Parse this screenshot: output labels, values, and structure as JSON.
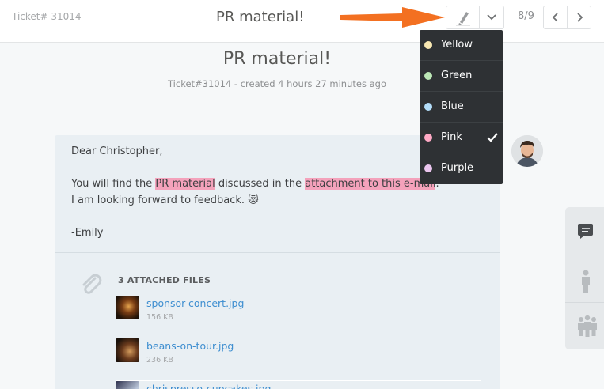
{
  "topbar": {
    "ticket_id": "Ticket# 31014",
    "title": "PR material!",
    "pager": "8/9"
  },
  "ticket": {
    "title": "PR material!",
    "meta": "Ticket#31014 - created 4 hours 27 minutes ago"
  },
  "article": {
    "greeting": "Dear Christopher,",
    "line1_pre": "You will find the ",
    "line1_hl1": "PR material",
    "line1_mid": " discussed in the ",
    "line1_hl2": "attachment to this e-mail",
    "line1_post": ".",
    "line2": "I am looking forward to feedback.",
    "emoji": "😻",
    "signature": "-Emily"
  },
  "attachments": {
    "title": "3 ATTACHED FILES",
    "files": [
      {
        "name": "sponsor-concert.jpg",
        "size": "156 KB"
      },
      {
        "name": "beans-on-tour.jpg",
        "size": "236 KB"
      },
      {
        "name": "chrispresso-cupcakes.jpg",
        "size": ""
      }
    ]
  },
  "highlight_menu": {
    "items": [
      {
        "label": "Yellow",
        "color": "#f7e7b2"
      },
      {
        "label": "Green",
        "color": "#bce7b6"
      },
      {
        "label": "Blue",
        "color": "#b3ddf9"
      },
      {
        "label": "Pink",
        "color": "#fea9c5",
        "selected": true
      },
      {
        "label": "Purple",
        "color": "#eac5ee"
      }
    ]
  },
  "colors": {
    "accent_arrow": "#f37021",
    "link": "#3e8ed0",
    "highlight_pink": "#f4a2bb"
  }
}
